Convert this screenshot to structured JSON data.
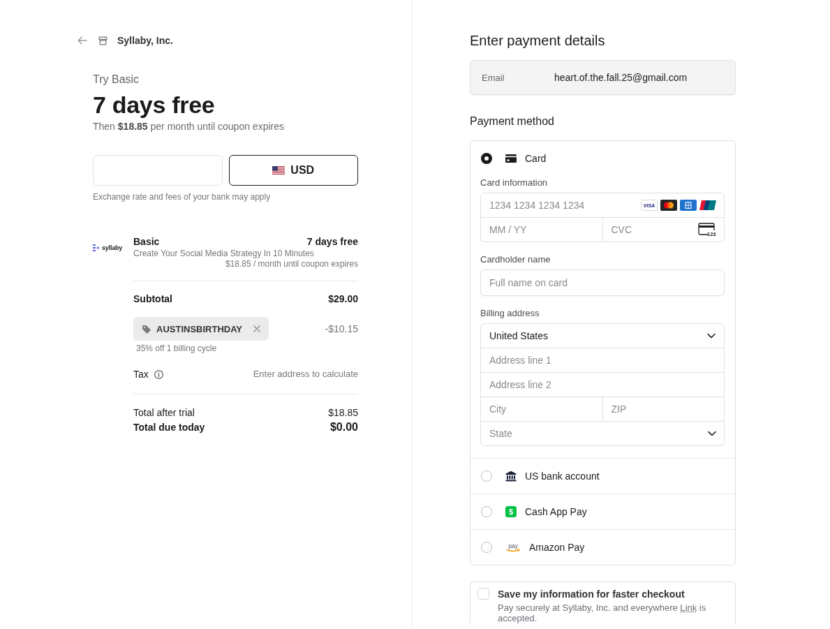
{
  "merchant": {
    "name": "Syllaby, Inc."
  },
  "offer": {
    "eyebrow": "Try Basic",
    "headline": "7 days free",
    "subline": "Then **$18.85** per month until coupon expires"
  },
  "currency_toggle": {
    "options": [
      {
        "kind": "blank",
        "selected": false
      },
      {
        "kind": "us_flag",
        "label": "USD",
        "selected": true
      }
    ],
    "note": "Exchange rate and fees of your bank may apply"
  },
  "line_item": {
    "logo_text": "syllaby",
    "name": "Basic",
    "price": "7 days free",
    "description": "Create Your Social Media Strategy In 10 Minutes",
    "price_note": "$18.85 / month until coupon expires"
  },
  "summary": {
    "subtotal": {
      "label": "Subtotal",
      "value": "$29.00"
    },
    "coupon": {
      "code": "AUSTINSBIRTHDAY",
      "value": "-$10.15",
      "note": "35% off 1 billing cycle"
    },
    "tax": {
      "label": "Tax",
      "value": "Enter address to calculate"
    },
    "totals": [
      {
        "kind": "after_trial",
        "label": "Total after trial",
        "value": "$18.85"
      },
      {
        "kind": "due_today",
        "label": "Total due today",
        "value": "$0.00"
      }
    ]
  },
  "payment": {
    "title": "Enter payment details",
    "email": {
      "label": "Email",
      "value": "heart.of.the.fall.25@gmail.com"
    },
    "method_heading": "Payment method",
    "methods": [
      {
        "kind": "card",
        "label": "Card",
        "selected": true
      },
      {
        "kind": "bank",
        "label": "US bank account",
        "selected": false
      },
      {
        "kind": "cashapp",
        "label": "Cash App Pay",
        "icon_text": "$",
        "selected": false
      },
      {
        "kind": "amazon",
        "label": "Amazon Pay",
        "icon_text": "pay",
        "selected": false
      }
    ],
    "card_form": {
      "card_label": "Card information",
      "number": {
        "placeholder": "1234 1234 1234 1234"
      },
      "brands": [
        {
          "kind": "visa",
          "label": "VISA"
        },
        {
          "kind": "mastercard"
        },
        {
          "kind": "amex"
        },
        {
          "kind": "unionpay"
        }
      ],
      "expiry": {
        "placeholder": "MM / YY"
      },
      "cvc": {
        "placeholder": "CVC",
        "icon_text": "123"
      },
      "cardholder_label": "Cardholder name",
      "cardholder": {
        "placeholder": "Full name on card"
      },
      "billing_label": "Billing address",
      "country": {
        "value": "United States"
      },
      "address_line1": {
        "placeholder": "Address line 1"
      },
      "address_line2": {
        "placeholder": "Address line 2"
      },
      "city": {
        "placeholder": "City"
      },
      "zip": {
        "placeholder": "ZIP"
      },
      "state": {
        "placeholder": "State"
      }
    }
  },
  "save_info": {
    "checked": false,
    "title": "Save my information for faster checkout",
    "text_before": "Pay securely at Syllaby, Inc. and everywhere ",
    "link": "Link",
    "text_after": " is accepted."
  }
}
